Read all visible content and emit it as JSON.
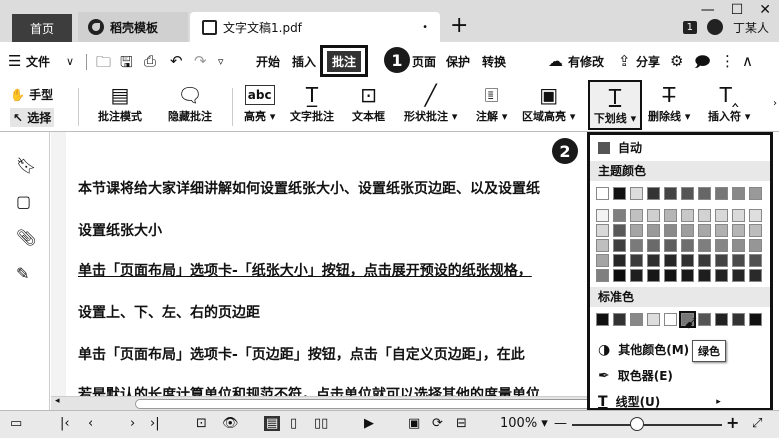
{
  "tabs": {
    "home": "首页",
    "template": "稻壳模板",
    "document": "文字文稿1.pdf",
    "modified_dot": "•",
    "new_tab": "+"
  },
  "window": {
    "badge": "1",
    "user": "丁某人",
    "minimize": "—",
    "maximize": "☐",
    "close": "✕"
  },
  "menu": {
    "file": "文件",
    "items": [
      "开始",
      "插入",
      "批注",
      "页面",
      "保护",
      "转换"
    ],
    "active": "批注",
    "modified": "有修改",
    "share": "分享"
  },
  "callouts": {
    "one": "1",
    "two": "2"
  },
  "ribbon": {
    "hand": "手型",
    "select": "选择",
    "buttons": [
      "批注模式",
      "隐藏批注",
      "高亮",
      "文字批注",
      "文本框",
      "形状批注",
      "注解",
      "区域高亮",
      "下划线",
      "删除线",
      "插入符"
    ]
  },
  "document": {
    "lines": [
      "本节课将给大家详细讲解如何设置纸张大小、设置纸张页边距、以及设置纸",
      "设置纸张大小",
      "单击「页面布局」选项卡-「纸张大小」按钮，点击展开预设的纸张规格，",
      "设置上、下、左、右的页边距",
      "单击「页面布局」选项卡-「页边距」按钮，点击「自定义页边距」，在此",
      "若是默认的长度计算单位和规范不符，点击单位就可以选择其他的度量单位"
    ]
  },
  "color_menu": {
    "auto": "自动",
    "theme_title": "主题颜色",
    "standard_title": "标准色",
    "more_colors": "其他颜色(M)",
    "picker": "取色器(E)",
    "line_style": "线型(U)",
    "tooltip": "绿色",
    "theme_top": [
      "#ffffff",
      "#111111",
      "#dddddd",
      "#333333",
      "#444444",
      "#555555",
      "#666666",
      "#777777",
      "#888888",
      "#999999"
    ],
    "theme_shades": [
      [
        "#f2f2f2",
        "#7f7f7f",
        "#c0c0c0",
        "#cfcfcf",
        "#b5b5b5",
        "#c8c8c8",
        "#d2d2d2",
        "#d8d8d8",
        "#dadada",
        "#dedede"
      ],
      [
        "#d9d9d9",
        "#595959",
        "#a5a5a5",
        "#9a9a9a",
        "#8a8a8a",
        "#9e9e9e",
        "#a8a8a8",
        "#b0b0b0",
        "#b5b5b5",
        "#bcbcbc"
      ],
      [
        "#bfbfbf",
        "#3f3f3f",
        "#7a7a7a",
        "#6a6a6a",
        "#5e5e5e",
        "#6e6e6e",
        "#7e7e7e",
        "#868686",
        "#8e8e8e",
        "#969696"
      ],
      [
        "#a5a5a5",
        "#262626",
        "#3c3c3c",
        "#2e2e2e",
        "#262626",
        "#303030",
        "#3a3a3a",
        "#444444",
        "#4a4a4a",
        "#505050"
      ],
      [
        "#7f7f7f",
        "#0d0d0d",
        "#1e1e1e",
        "#161616",
        "#121212",
        "#181818",
        "#1e1e1e",
        "#222222",
        "#262626",
        "#2a2a2a"
      ]
    ],
    "standard": [
      "#111111",
      "#333333",
      "#888888",
      "#dddddd",
      "#ffffff",
      "#777777",
      "#555555",
      "#222222",
      "#333333",
      "#111111"
    ]
  },
  "status": {
    "zoom": "100%",
    "minus": "—",
    "plus": "+"
  }
}
